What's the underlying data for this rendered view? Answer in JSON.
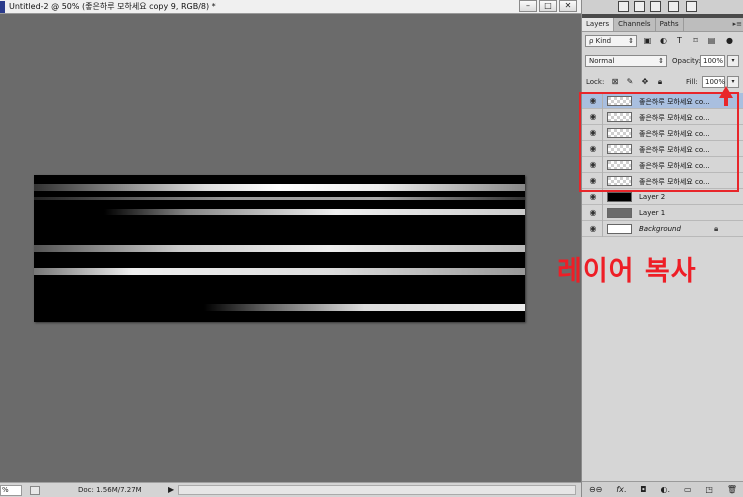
{
  "document": {
    "title": "Untitled-2 @ 50% (좋은하루 모하세요 copy 9, RGB/8) *",
    "window_controls": [
      "–",
      "□",
      "✕"
    ]
  },
  "status": {
    "zoom": "%",
    "doc_size": "Doc: 1.56M/7.27M",
    "arrow": "▶"
  },
  "panel": {
    "tabs": [
      "Layers",
      "Channels",
      "Paths"
    ],
    "filter_kind": "ρ Kind",
    "blend_mode": "Normal",
    "opacity_label": "Opacity:",
    "opacity_value": "100%",
    "lock_label": "Lock:",
    "fill_label": "Fill:",
    "fill_value": "100%",
    "layers": [
      {
        "name": "좋은하루 모하세요 co...",
        "thumb": "checker",
        "selected": true
      },
      {
        "name": "좋은하루 모하세요 co...",
        "thumb": "checker",
        "selected": false
      },
      {
        "name": "좋은하루 모하세요 co...",
        "thumb": "checker",
        "selected": false
      },
      {
        "name": "좋은하루 모하세요 co...",
        "thumb": "checker",
        "selected": false
      },
      {
        "name": "좋은하루 모하세요 co...",
        "thumb": "checker",
        "selected": false
      },
      {
        "name": "좋은하루 모하세요 co...",
        "thumb": "checker",
        "selected": false
      },
      {
        "name": "Layer 2",
        "thumb": "black",
        "selected": false
      },
      {
        "name": "Layer 1",
        "thumb": "grey",
        "selected": false
      },
      {
        "name": "Background",
        "thumb": "white",
        "selected": false,
        "locked": true
      }
    ]
  },
  "annotation": "레이어 복사",
  "colors": {
    "canvas_bg": "#6b6b6b",
    "annotation_red": "#ee1e26",
    "selected_layer": "#a9bfdf"
  }
}
